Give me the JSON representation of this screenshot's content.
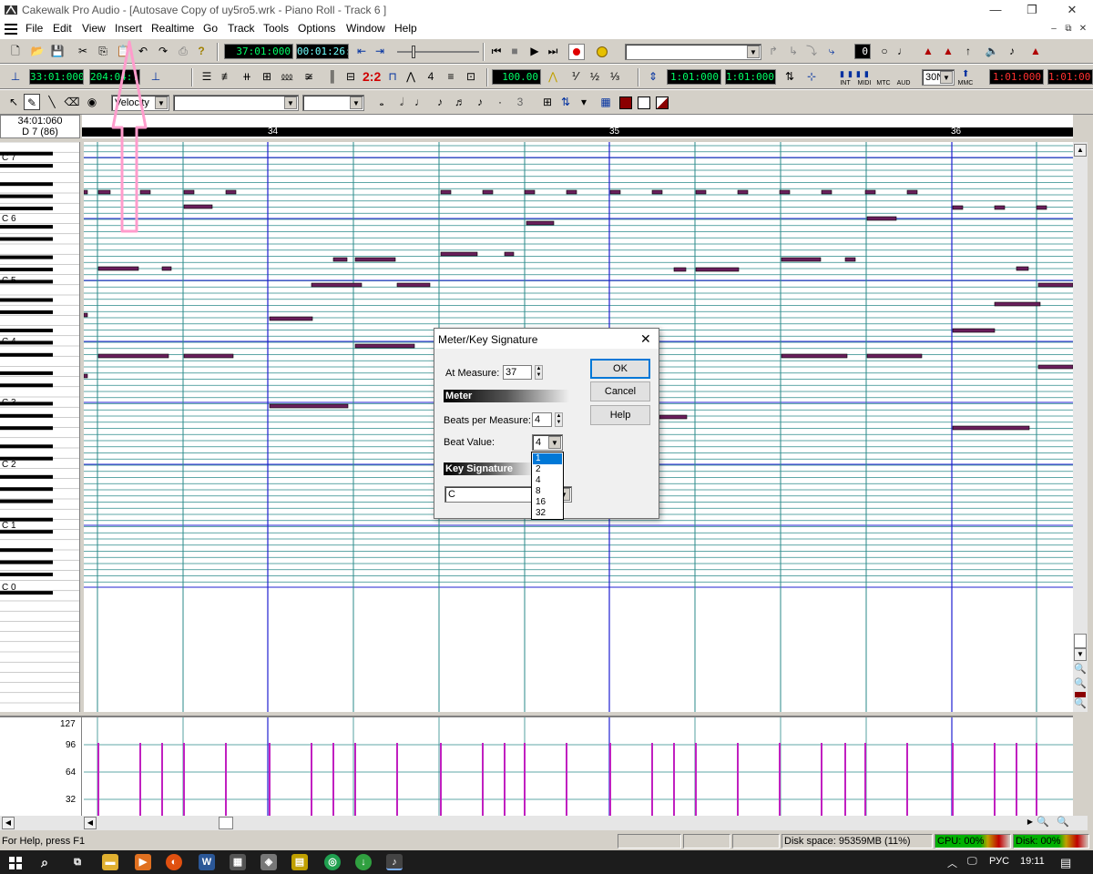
{
  "window": {
    "title": "Cakewalk Pro Audio - [Autosave Copy of uy5ro5.wrk - Piano Roll - Track 6 ]",
    "minimize": "—",
    "restore": "❐",
    "close": "✕"
  },
  "menu": {
    "items": [
      "File",
      "Edit",
      "View",
      "Insert",
      "Realtime",
      "Go",
      "Track",
      "Tools",
      "Options",
      "Window",
      "Help"
    ],
    "mdi": [
      "–",
      "⧉",
      "✕"
    ]
  },
  "toolbar1": {
    "now_time": "37:01:000",
    "smpte": "00:01:26:12",
    "lcd_zero": "0"
  },
  "toolbar2": {
    "from_time": "33:01:000",
    "to_time": "204:04:...",
    "tempo": "100.00",
    "sig": "2:2",
    "loop_from": "1:01:000",
    "loop_to": "1:01:000",
    "fps": "30N",
    "sync_labels": [
      "INT",
      "MIDI",
      "MTC",
      "AUD",
      "MMC"
    ],
    "punch_in": "1:01:000",
    "punch_out": "1:01:00"
  },
  "toolbar3": {
    "controller_combo": "Velocity",
    "triplet": "3"
  },
  "pianoroll": {
    "position": "34:01:060",
    "pitch": "D 7 (86)",
    "measures": [
      "34",
      "35",
      "36"
    ],
    "octave_labels": [
      "C 7",
      "C 6",
      "C 5",
      "C 4",
      "C 3",
      "C 2",
      "C 1",
      "C 0"
    ],
    "velocity_labels": [
      "127",
      "96",
      "64",
      "32"
    ]
  },
  "dialog": {
    "title": "Meter/Key Signature",
    "at_measure_label": "At Measure:",
    "at_measure_value": "37",
    "meter_section": "Meter",
    "beats_label": "Beats per Measure:",
    "beats_value": "4",
    "beat_value_label": "Beat Value:",
    "beat_value": "4",
    "key_section": "Key Signature",
    "key_value": "C",
    "ok": "OK",
    "cancel": "Cancel",
    "help": "Help",
    "beat_options": [
      "1",
      "2",
      "4",
      "8",
      "16",
      "32"
    ],
    "selected_option": "1"
  },
  "status": {
    "help": "For Help, press F1",
    "disk": "Disk space: 95359MB (11%)",
    "cpu": "CPU: 00%",
    "disk_load": "Disk: 00%"
  },
  "taskbar": {
    "lang": "РУС",
    "clock": "19:11"
  },
  "colors": {
    "note": "#6a1f5c",
    "grid_line": "#2a8a8a",
    "octave_line": "#2020d0",
    "velocity": "#c020c0",
    "annotation": "#ff9ccc"
  }
}
